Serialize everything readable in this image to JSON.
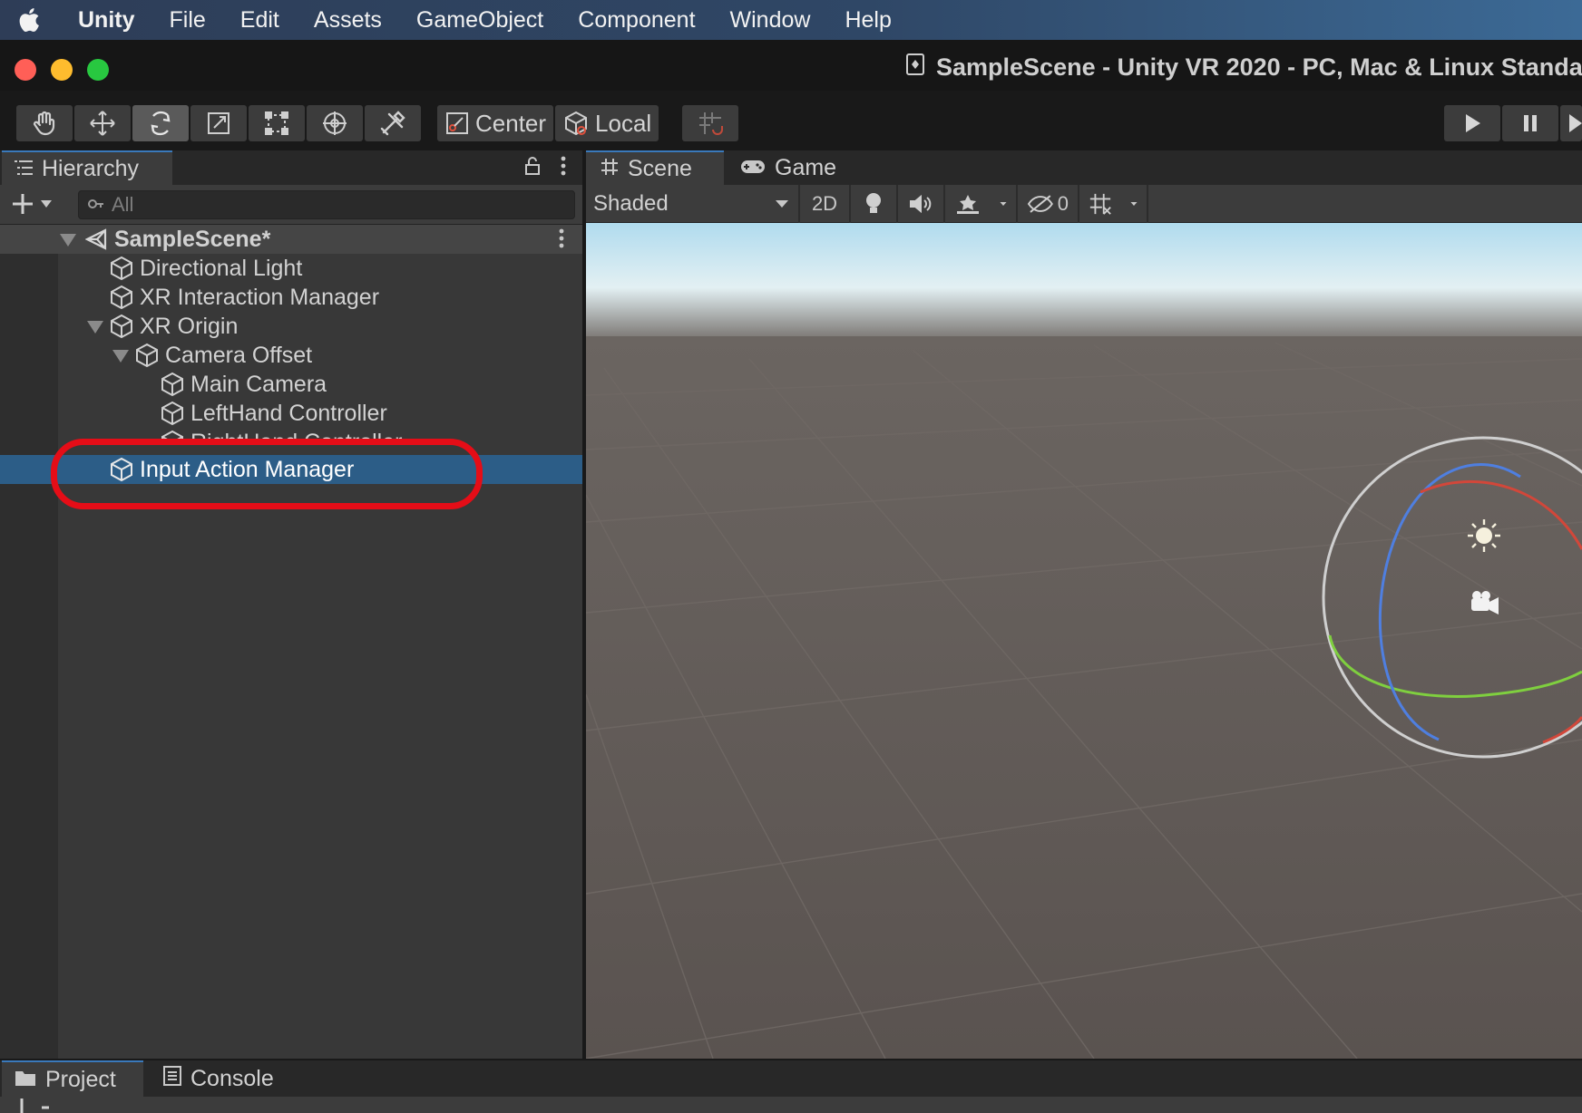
{
  "menubar": {
    "apple_icon": "apple-logo-icon",
    "items": [
      "Unity",
      "File",
      "Edit",
      "Assets",
      "GameObject",
      "Component",
      "Window",
      "Help"
    ]
  },
  "window": {
    "title": "SampleScene - Unity VR 2020 - PC, Mac & Linux Standa",
    "traffic_colors": {
      "close": "#ff5f57",
      "minimize": "#febc2e",
      "maximize": "#28c840"
    }
  },
  "toolbar": {
    "transform_tools": [
      "hand-tool-icon",
      "move-tool-icon",
      "rotate-tool-icon",
      "scale-tool-icon",
      "rect-tool-icon",
      "transform-tool-icon",
      "custom-tool-icon"
    ],
    "active_tool": "rotate-tool-icon",
    "pivot_label": "Center",
    "space_label": "Local"
  },
  "hierarchy": {
    "tab_label": "Hierarchy",
    "search_placeholder": "All",
    "scene_name": "SampleScene*",
    "items": [
      {
        "label": "Directional Light",
        "depth": 1
      },
      {
        "label": "XR Interaction Manager",
        "depth": 1
      },
      {
        "label": "XR Origin",
        "depth": 1,
        "expanded": true
      },
      {
        "label": "Camera Offset",
        "depth": 2,
        "expanded": true
      },
      {
        "label": "Main Camera",
        "depth": 3
      },
      {
        "label": "LeftHand Controller",
        "depth": 3
      },
      {
        "label": "RightHand Controller",
        "depth": 3
      },
      {
        "label": "Input Action Manager",
        "depth": 1,
        "selected": true
      }
    ],
    "selection_color": "#2c5d87",
    "annotation_color": "#e50d17"
  },
  "scene_view": {
    "tabs": [
      "Scene",
      "Game"
    ],
    "active_tab": "Scene",
    "shading_mode": "Shaded",
    "mode_2d_label": "2D",
    "hidden_count": "0",
    "gizmo_colors": {
      "x": "#d2473a",
      "y": "#7fcf3f",
      "z": "#4f7fe0"
    }
  },
  "bottom_panel": {
    "tabs": [
      "Project",
      "Console"
    ],
    "active_tab": "Project"
  }
}
